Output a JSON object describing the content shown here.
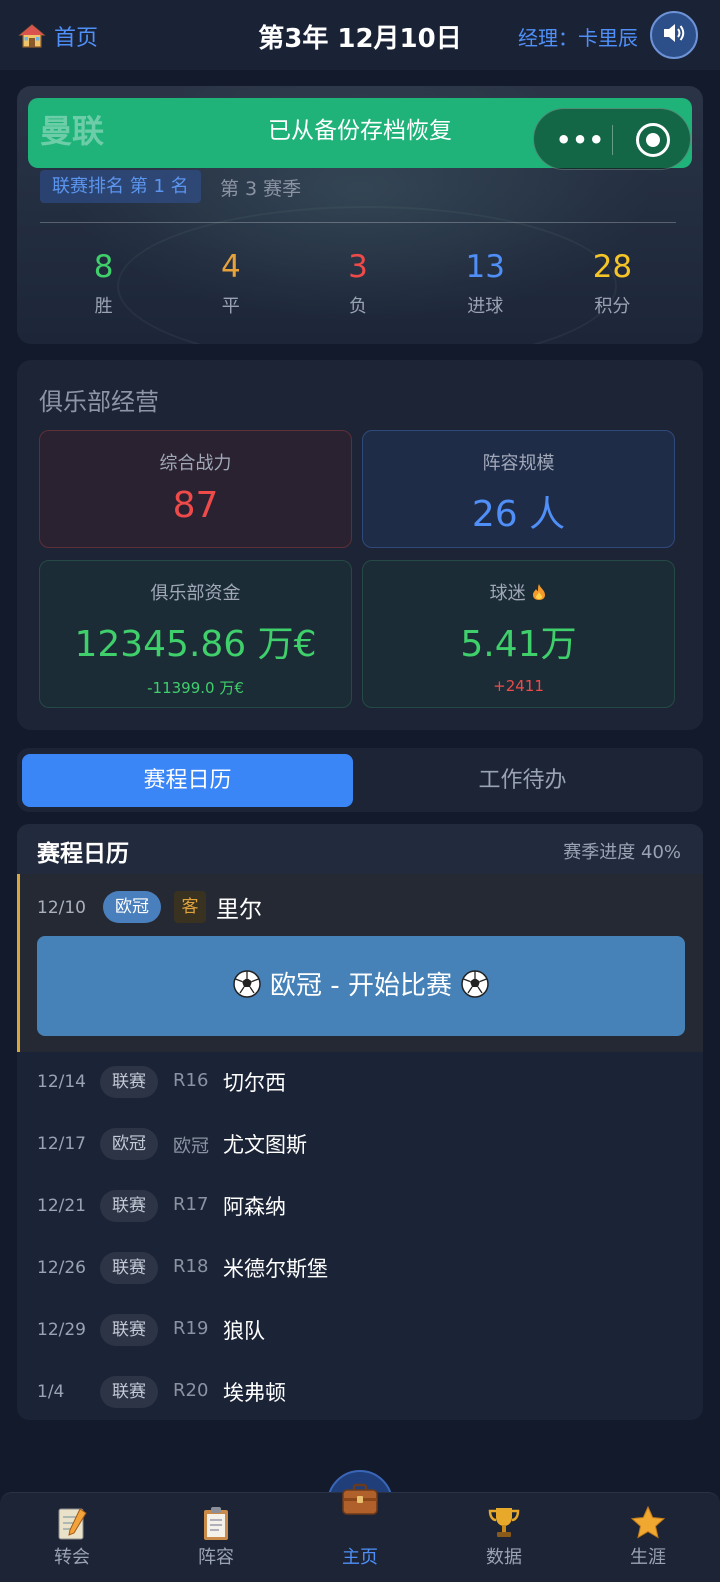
{
  "topbar": {
    "home_label": "首页",
    "date": "第3年 12月10日",
    "manager": "经理：卡里辰"
  },
  "hero": {
    "team": "曼联",
    "toast": "已从备份存档恢复",
    "rank": "联赛排名 第 1 名",
    "season": "第 3 赛季",
    "stats": [
      {
        "value": "8",
        "label": "胜",
        "color": "#3fcf6b"
      },
      {
        "value": "4",
        "label": "平",
        "color": "#e8a23a"
      },
      {
        "value": "3",
        "label": "负",
        "color": "#ef4a4a"
      },
      {
        "value": "13",
        "label": "进球",
        "color": "#4f8ff7"
      },
      {
        "value": "28",
        "label": "积分",
        "color": "#f5c427"
      }
    ]
  },
  "club": {
    "title": "俱乐部经营",
    "power_label": "综合战力",
    "power_value": "87",
    "squad_label": "阵容规模",
    "squad_value": "26 人",
    "funds_label": "俱乐部资金",
    "funds_value": "12345.86 万€",
    "funds_change": "-11399.0 万€",
    "fans_label": "球迷",
    "fans_value": "5.41万",
    "fans_change": "+2411"
  },
  "tabs": {
    "schedule": "赛程日历",
    "todo": "工作待办"
  },
  "schedule": {
    "title": "赛程日历",
    "progress": "赛季进度 40%",
    "next": {
      "date": "12/10",
      "comp": "欧冠",
      "venue": "客",
      "opponent": "里尔",
      "button": "欧冠 - 开始比赛"
    },
    "fixtures": [
      {
        "date": "12/14",
        "comp": "联赛",
        "round": "R16",
        "opponent": "切尔西"
      },
      {
        "date": "12/17",
        "comp": "欧冠",
        "round": "欧冠",
        "opponent": "尤文图斯"
      },
      {
        "date": "12/21",
        "comp": "联赛",
        "round": "R17",
        "opponent": "阿森纳"
      },
      {
        "date": "12/26",
        "comp": "联赛",
        "round": "R18",
        "opponent": "米德尔斯堡"
      },
      {
        "date": "12/29",
        "comp": "联赛",
        "round": "R19",
        "opponent": "狼队"
      },
      {
        "date": "1/4",
        "comp": "联赛",
        "round": "R20",
        "opponent": "埃弗顿"
      }
    ]
  },
  "nav": {
    "transfer": "转会",
    "lineup": "阵容",
    "home": "主页",
    "data": "数据",
    "career": "生涯"
  },
  "colors": {
    "accent": "#3b86f7",
    "toast": "#1fb37a",
    "power": "#ef4a4a",
    "squad": "#4f8ff7",
    "money": "#3fcf6b",
    "negative": "#ef4a4a"
  }
}
